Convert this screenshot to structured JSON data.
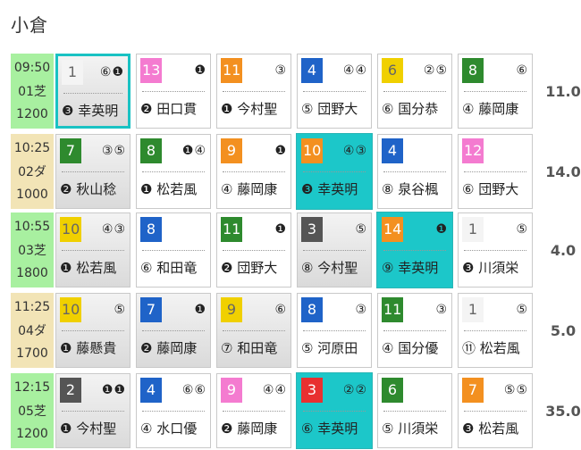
{
  "page": {
    "title": "小倉"
  },
  "races": [
    {
      "time": "09:50",
      "course": "01芝",
      "distance": "1200",
      "surface": "turf",
      "odds": "11.0",
      "cells": [
        {
          "num": "1",
          "color": "c1",
          "marks": "⑥❶",
          "horse": "❸ 幸英明",
          "style": "gray hl"
        },
        {
          "num": "13",
          "color": "c8",
          "marks": "❶",
          "horse": "❷ 田口貫",
          "style": ""
        },
        {
          "num": "11",
          "color": "c7",
          "marks": "③",
          "horse": "❶ 今村聖",
          "style": ""
        },
        {
          "num": "4",
          "color": "c4",
          "marks": "④④",
          "horse": "⑤ 団野大",
          "style": ""
        },
        {
          "num": "6",
          "color": "c5",
          "marks": "②⑤",
          "horse": "⑥ 国分恭",
          "style": ""
        },
        {
          "num": "8",
          "color": "c6",
          "marks": "⑥",
          "horse": "④ 藤岡康",
          "style": ""
        }
      ]
    },
    {
      "time": "10:25",
      "course": "02ダ",
      "distance": "1000",
      "surface": "dirt",
      "odds": "14.0",
      "cells": [
        {
          "num": "7",
          "color": "c6",
          "marks": "③⑤",
          "horse": "❷ 秋山稔",
          "style": "gray"
        },
        {
          "num": "8",
          "color": "c6",
          "marks": "❶④",
          "horse": "❶ 松若風",
          "style": ""
        },
        {
          "num": "9",
          "color": "c7",
          "marks": "❶",
          "horse": "④ 藤岡康",
          "style": ""
        },
        {
          "num": "10",
          "color": "c7",
          "marks": "④③",
          "horse": "❸ 幸英明",
          "style": "teal"
        },
        {
          "num": "4",
          "color": "c4",
          "marks": "",
          "horse": "⑧ 泉谷楓",
          "style": ""
        },
        {
          "num": "12",
          "color": "c8",
          "marks": "",
          "horse": "⑥ 団野大",
          "style": ""
        }
      ]
    },
    {
      "time": "10:55",
      "course": "03芝",
      "distance": "1800",
      "surface": "turf",
      "odds": "4.0",
      "cells": [
        {
          "num": "10",
          "color": "c5",
          "marks": "④③",
          "horse": "❶ 松若風",
          "style": "gray"
        },
        {
          "num": "8",
          "color": "c4",
          "marks": "",
          "horse": "⑥ 和田竜",
          "style": ""
        },
        {
          "num": "11",
          "color": "c6",
          "marks": "❶",
          "horse": "❷ 団野大",
          "style": ""
        },
        {
          "num": "3",
          "color": "c2",
          "marks": "⑤",
          "horse": "⑧ 今村聖",
          "style": "gray"
        },
        {
          "num": "14",
          "color": "c7",
          "marks": "❶",
          "horse": "⑨ 幸英明",
          "style": "teal"
        },
        {
          "num": "1",
          "color": "c1",
          "marks": "⑤",
          "horse": "❸ 川須栄",
          "style": ""
        }
      ]
    },
    {
      "time": "11:25",
      "course": "04ダ",
      "distance": "1700",
      "surface": "dirt",
      "odds": "5.0",
      "cells": [
        {
          "num": "10",
          "color": "c5",
          "marks": "⑤",
          "horse": "❶ 藤懸貴",
          "style": "gray"
        },
        {
          "num": "7",
          "color": "c4",
          "marks": "❶",
          "horse": "❷ 藤岡康",
          "style": "gray"
        },
        {
          "num": "9",
          "color": "c5",
          "marks": "⑥",
          "horse": "⑦ 和田竜",
          "style": "gray"
        },
        {
          "num": "8",
          "color": "c4",
          "marks": "③",
          "horse": "⑤ 河原田",
          "style": ""
        },
        {
          "num": "11",
          "color": "c6",
          "marks": "③",
          "horse": "④ 国分優",
          "style": ""
        },
        {
          "num": "1",
          "color": "c1",
          "marks": "⑤",
          "horse": "⑪ 松若風",
          "style": ""
        }
      ]
    },
    {
      "time": "12:15",
      "course": "05芝",
      "distance": "1200",
      "surface": "turf",
      "odds": "35.0",
      "cells": [
        {
          "num": "2",
          "color": "c2",
          "marks": "❶❶",
          "horse": "❶ 今村聖",
          "style": "gray"
        },
        {
          "num": "4",
          "color": "c4",
          "marks": "⑥⑥",
          "horse": "④ 水口優",
          "style": ""
        },
        {
          "num": "9",
          "color": "c8",
          "marks": "④④",
          "horse": "❷ 藤岡康",
          "style": ""
        },
        {
          "num": "3",
          "color": "c3",
          "marks": "②②",
          "horse": "⑥ 幸英明",
          "style": "teal"
        },
        {
          "num": "6",
          "color": "c6",
          "marks": "",
          "horse": "⑤ 川須栄",
          "style": ""
        },
        {
          "num": "7",
          "color": "c7",
          "marks": "⑤⑤",
          "horse": "❸ 松若風",
          "style": ""
        }
      ]
    }
  ]
}
